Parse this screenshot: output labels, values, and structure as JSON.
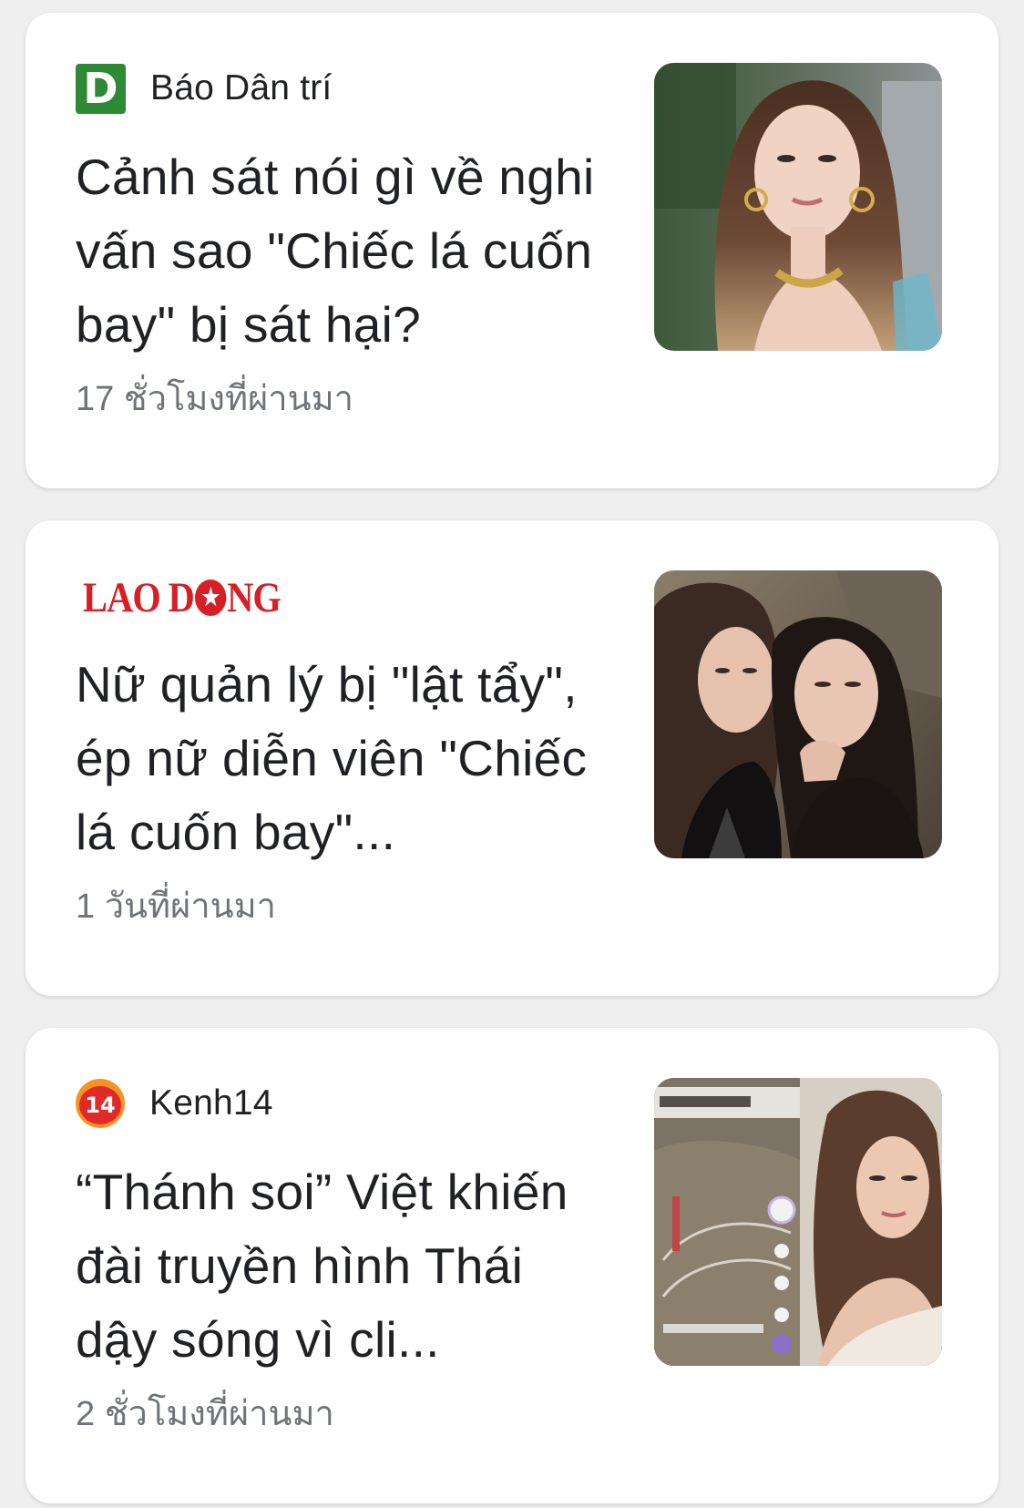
{
  "feed": {
    "articles": [
      {
        "source": {
          "name": "Báo Dân trí",
          "logo_text": "D",
          "logo_icon": "dantri-logo-icon",
          "logo_color": "#2f8a35"
        },
        "headline": "Cảnh sát nói gì về nghi vấn sao \"Chiếc lá cuốn bay\" bị sát hại?",
        "timestamp": "17 ชั่วโมงที่ผ่านมา",
        "thumbnail": "portrait-photo-woman-gold-earrings"
      },
      {
        "source": {
          "logo_text_1": "LAO",
          "logo_text_2": "D",
          "logo_text_3": "NG",
          "logo_star": "★",
          "logo_icon": "laodong-logo-icon",
          "logo_color": "#d81f26"
        },
        "headline": "Nữ quản lý bị \"lật tẩy\", ép nữ diễn viên \"Chiếc lá cuốn bay\"...",
        "timestamp": "1 วันที่ผ่านมา",
        "thumbnail": "photo-two-women-selfie"
      },
      {
        "source": {
          "name": "Kenh14",
          "logo_text": "14",
          "logo_icon": "kenh14-logo-icon",
          "logo_color": "#e02a2a"
        },
        "headline": "“Thánh soi” Việt khiến đài truyền hình Thái dậy sóng vì cli...",
        "timestamp": "2 ชั่วโมงที่ผ่านมา",
        "thumbnail": "photo-collage-video-screenshot-and-portrait"
      }
    ]
  }
}
